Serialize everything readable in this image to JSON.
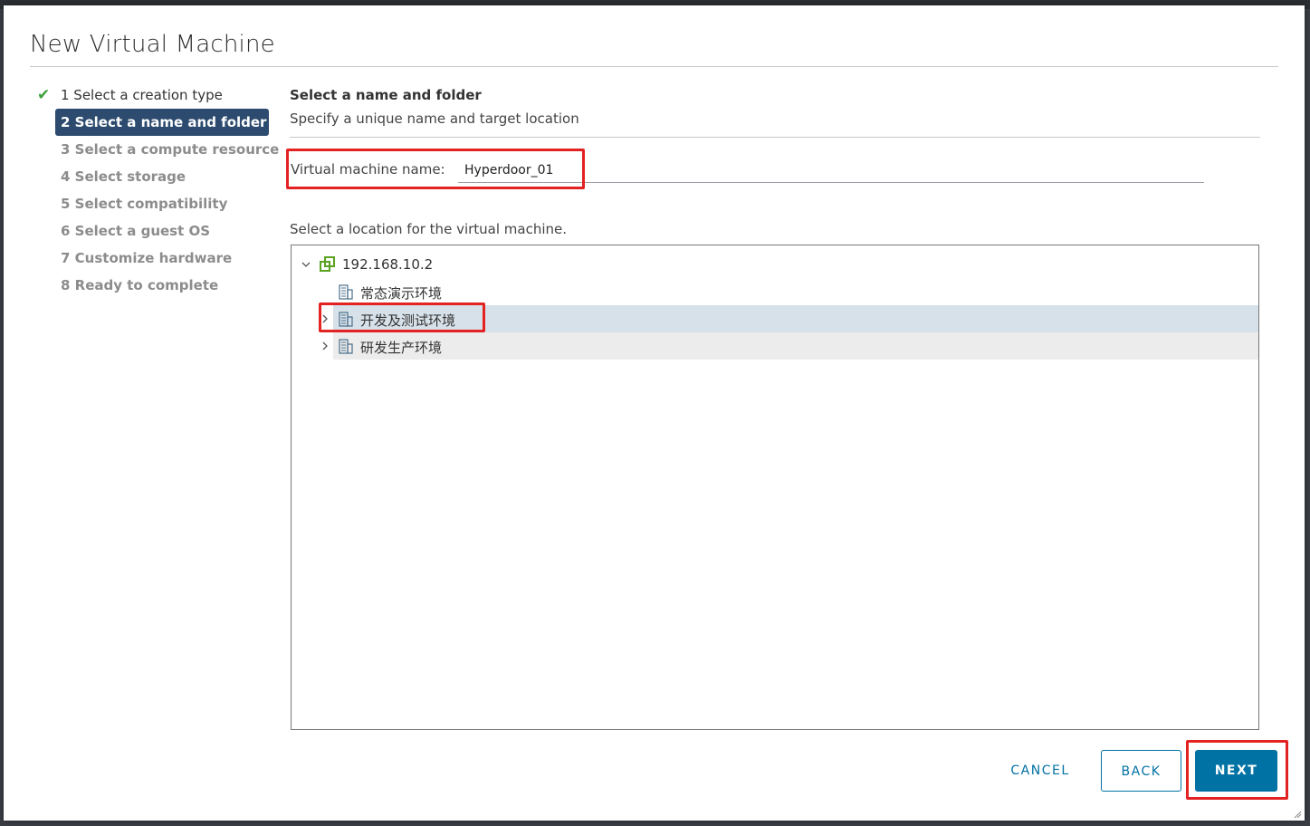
{
  "background": {
    "partial_text": "…"
  },
  "dialog": {
    "title": "New Virtual Machine"
  },
  "steps": [
    {
      "label": "1 Select a creation type",
      "state": "done"
    },
    {
      "label": "2 Select a name and folder",
      "state": "active"
    },
    {
      "label": "3 Select a compute resource",
      "state": "pending"
    },
    {
      "label": "4 Select storage",
      "state": "pending"
    },
    {
      "label": "5 Select compatibility",
      "state": "pending"
    },
    {
      "label": "6 Select a guest OS",
      "state": "pending"
    },
    {
      "label": "7 Customize hardware",
      "state": "pending"
    },
    {
      "label": "8 Ready to complete",
      "state": "pending"
    }
  ],
  "section": {
    "title": "Select a name and folder",
    "subtitle": "Specify a unique name and target location"
  },
  "vm_name": {
    "label": "Virtual machine name:",
    "value": "Hyperdoor_01"
  },
  "location": {
    "label": "Select a location for the virtual machine.",
    "tree": {
      "root": "192.168.10.2",
      "children": [
        {
          "label": "常态演示环境",
          "expandable": false
        },
        {
          "label": "开发及测试环境",
          "expandable": true,
          "highlighted": true
        },
        {
          "label": "研发生产环境",
          "expandable": true
        }
      ]
    }
  },
  "buttons": {
    "cancel": "CANCEL",
    "back": "BACK",
    "next": "NEXT"
  },
  "colors": {
    "accent": "#0072a3",
    "active_step": "#2d4b6e",
    "highlight_box": "#e32222",
    "check": "#3c9e3c"
  }
}
